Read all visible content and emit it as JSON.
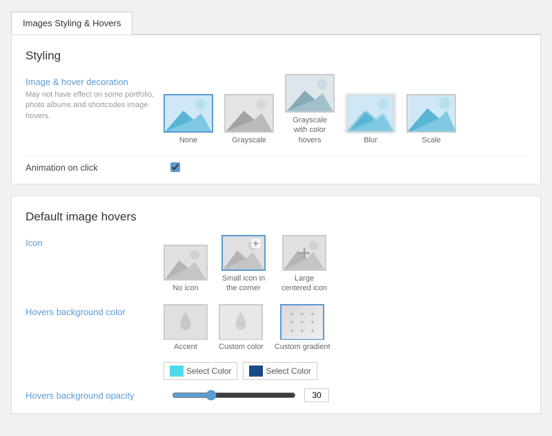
{
  "tab": {
    "label": "Images Styling & Hovers"
  },
  "styling_section": {
    "title": "Styling",
    "decoration_label": "Image & hover decoration",
    "decoration_desc": "May not have effect on some portfolio, photo albums and shortcodes image hovers.",
    "options": [
      {
        "id": "none",
        "label": "None",
        "selected": true
      },
      {
        "id": "grayscale",
        "label": "Grayscale",
        "selected": false
      },
      {
        "id": "grayscale-color",
        "label": "Grayscale with color hovers",
        "selected": false
      },
      {
        "id": "blur",
        "label": "Blur",
        "selected": false
      },
      {
        "id": "scale",
        "label": "Scale",
        "selected": false
      }
    ],
    "animation_label": "Animation on click",
    "animation_checked": true
  },
  "hover_section": {
    "title": "Default image hovers",
    "icon_label": "Icon",
    "icon_options": [
      {
        "id": "no-icon",
        "label": "No icon",
        "selected": false
      },
      {
        "id": "small-icon",
        "label": "Small icon in the corner",
        "selected": true
      },
      {
        "id": "large-icon",
        "label": "Large centered icon",
        "selected": false
      }
    ],
    "bg_color_label": "Hovers background color",
    "bg_color_options": [
      {
        "id": "accent",
        "label": "Accent",
        "selected": false
      },
      {
        "id": "custom",
        "label": "Custom color",
        "selected": false
      },
      {
        "id": "gradient",
        "label": "Custom gradient",
        "selected": true
      }
    ],
    "select_color_btn1": "Select Color",
    "select_color_btn2": "Select Color",
    "swatch1_color": "#4dd9e8",
    "swatch2_color": "#1a4a8a",
    "opacity_label": "Hovers background opacity",
    "opacity_value": "30"
  }
}
